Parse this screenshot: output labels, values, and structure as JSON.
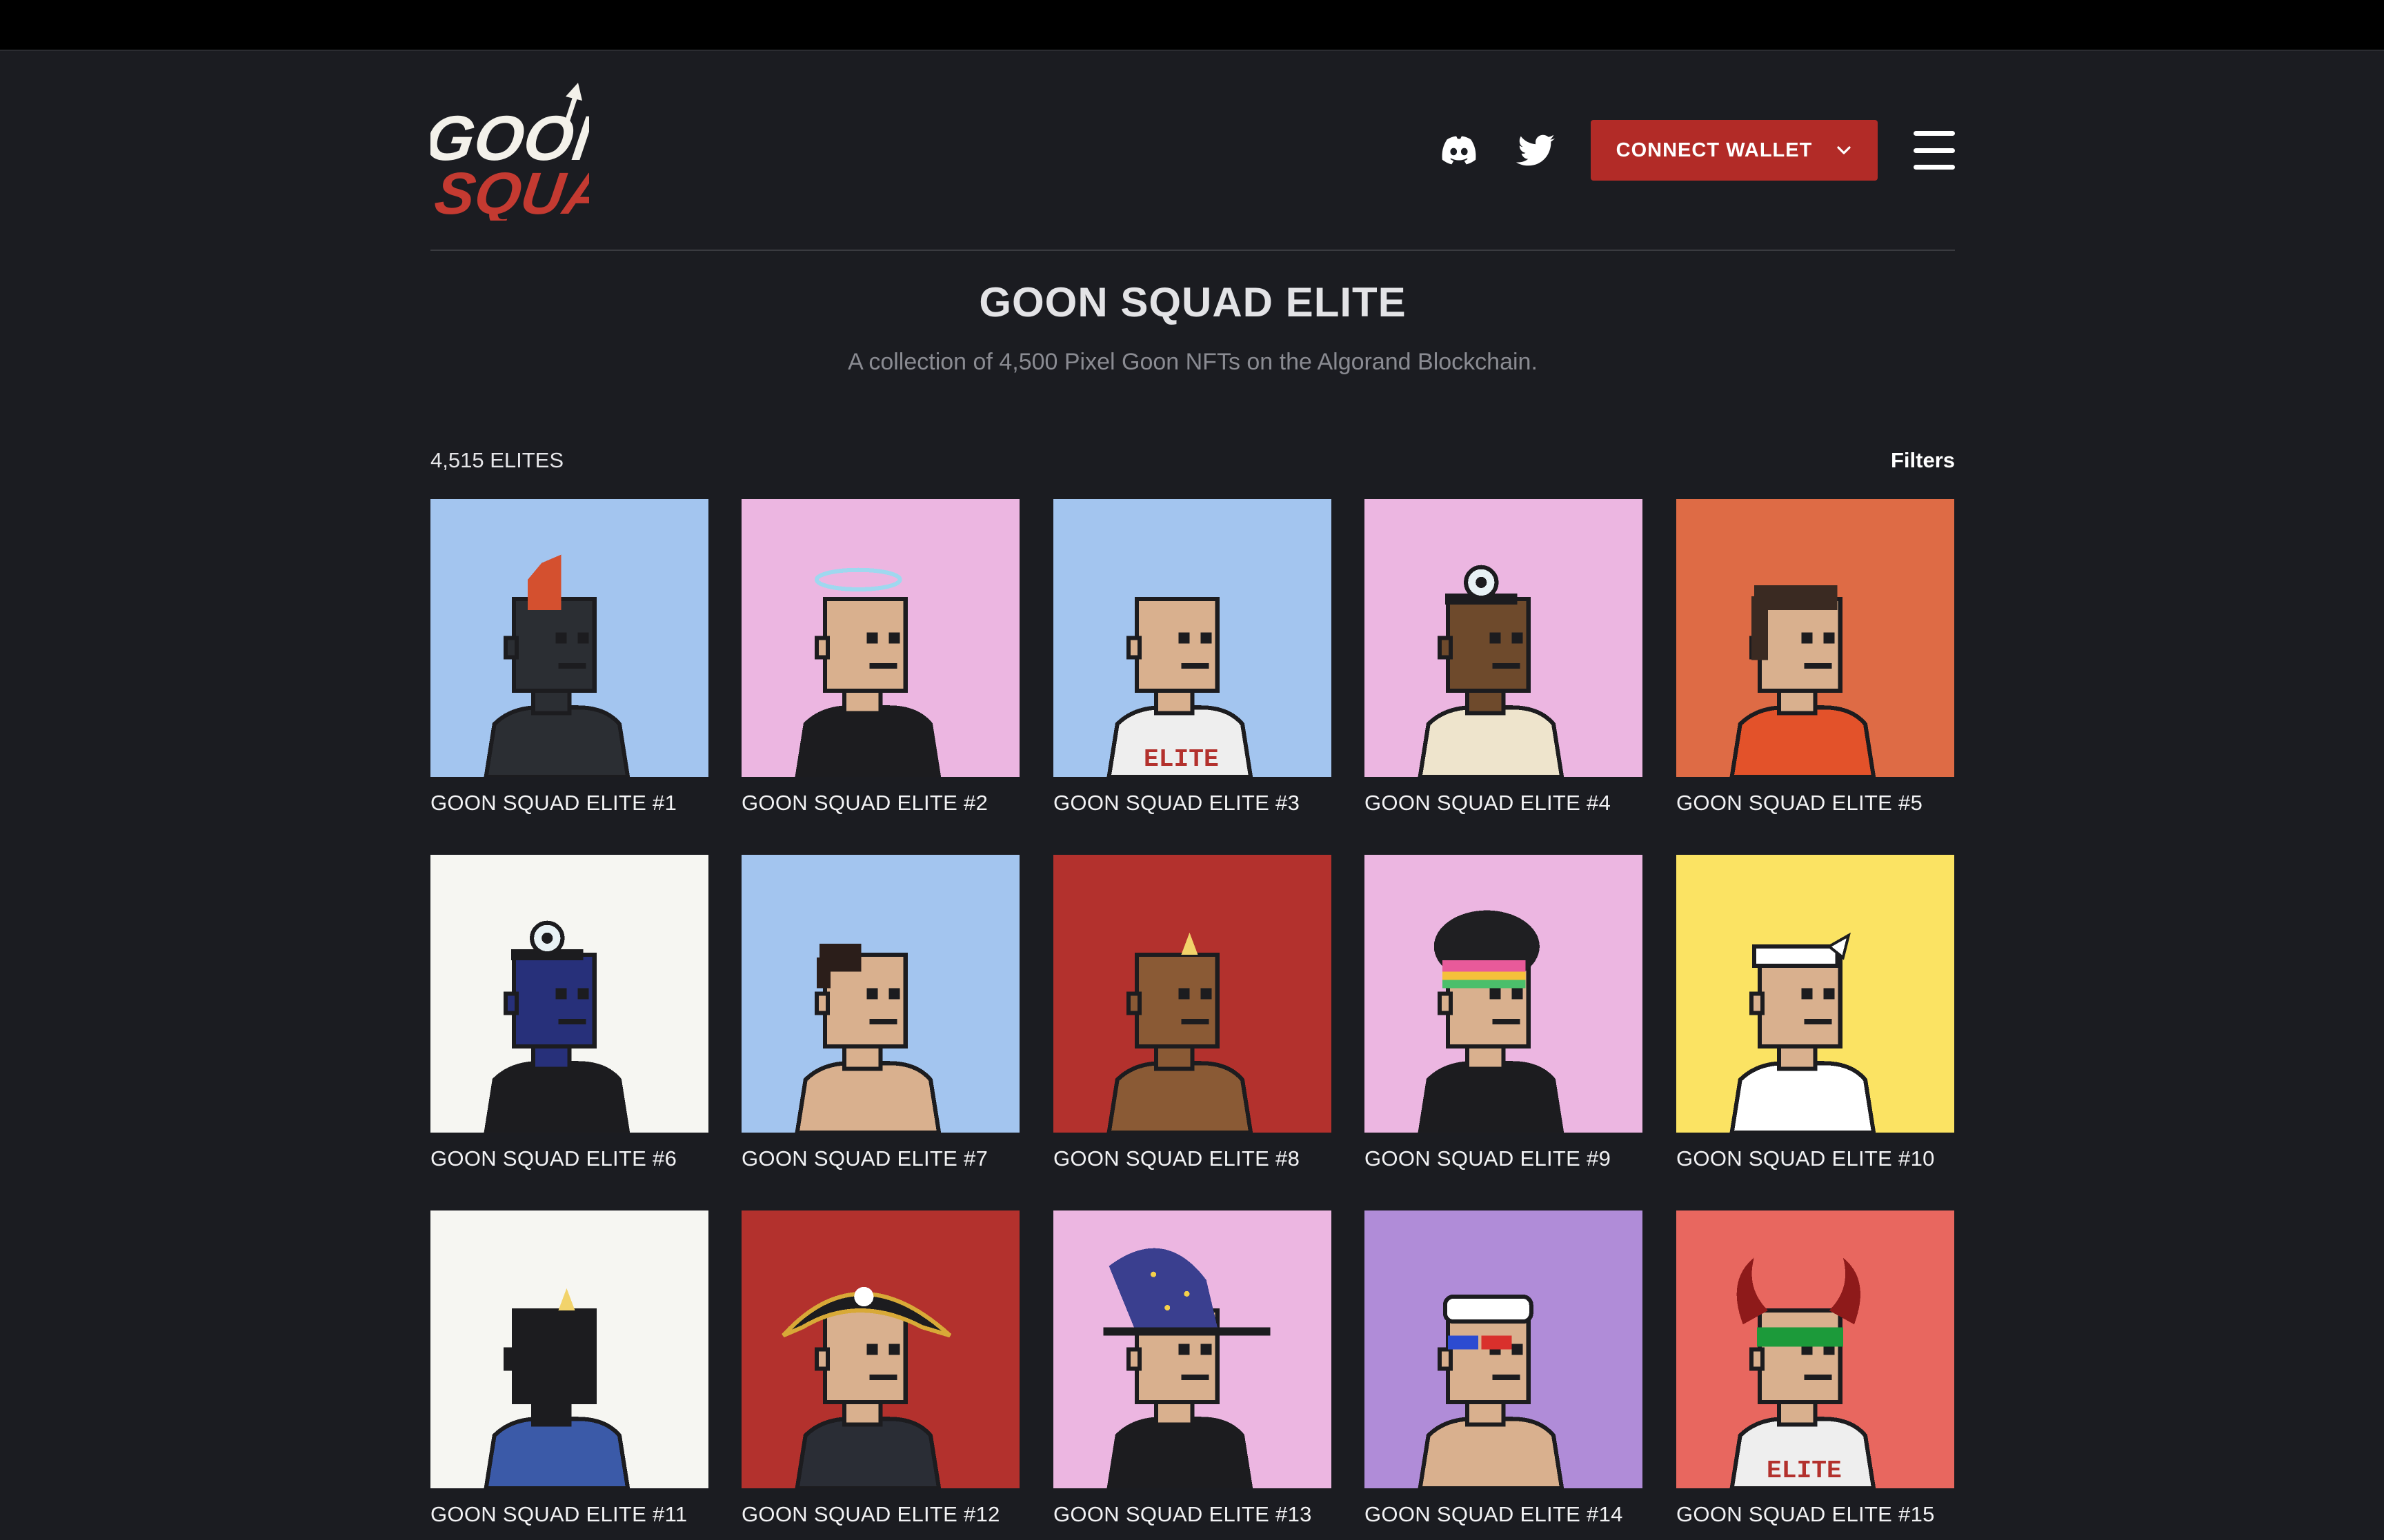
{
  "header": {
    "logo_text": [
      "GOON",
      "SQUAD"
    ],
    "connect_label": "CONNECT WALLET",
    "icons": {
      "discord": "discord-icon",
      "twitter": "twitter-icon",
      "menu": "hamburger-menu-icon",
      "chevron": "chevron-down-icon"
    }
  },
  "hero": {
    "title": "GOON SQUAD ELITE",
    "subtitle": "A collection of 4,500 Pixel Goon NFTs on the Algorand Blockchain."
  },
  "collection": {
    "count_label": "4,515 ELITES",
    "filters_label": "Filters",
    "items": [
      {
        "name": "GOON SQUAD ELITE #1",
        "bg": "#a3c5ef",
        "skin": "#2b2e33",
        "hat": "mohawk",
        "hatColor": "#d4502f",
        "outfit": "#2b2e33"
      },
      {
        "name": "GOON SQUAD ELITE #2",
        "bg": "#ecb6e1",
        "skin": "#d9b08e",
        "hat": "halo",
        "hatColor": "#9fd8ef",
        "outfit": "#1c1c1f"
      },
      {
        "name": "GOON SQUAD ELITE #3",
        "bg": "#a3c5ef",
        "skin": "#d9b08e",
        "hat": "none",
        "hatColor": "",
        "outfit": "#eeeeee",
        "shirtText": "ELITE"
      },
      {
        "name": "GOON SQUAD ELITE #4",
        "bg": "#ecb6e1",
        "skin": "#6e4a2c",
        "hat": "lamp",
        "hatColor": "#e8f2f5",
        "outfit": "#eee4cc"
      },
      {
        "name": "GOON SQUAD ELITE #5",
        "bg": "#de6b45",
        "skin": "#d9b08e",
        "hat": "longhair",
        "hatColor": "#3a2a22",
        "outfit": "#e3522a"
      },
      {
        "name": "GOON SQUAD ELITE #6",
        "bg": "#f6f6f2",
        "skin": "#27307a",
        "hat": "lamp",
        "hatColor": "#e8f2f5",
        "outfit": "#1c1c1f"
      },
      {
        "name": "GOON SQUAD ELITE #7",
        "bg": "#a3c5ef",
        "skin": "#d9b08e",
        "hat": "hair",
        "hatColor": "#2b1e1a",
        "outfit": "#d9b08e"
      },
      {
        "name": "GOON SQUAD ELITE #8",
        "bg": "#b3312d",
        "skin": "#8a5a35",
        "hat": "horn",
        "hatColor": "#f2d36b",
        "outfit": "#8a5a35"
      },
      {
        "name": "GOON SQUAD ELITE #9",
        "bg": "#ecb6e1",
        "skin": "#d9b08e",
        "hat": "afro",
        "hatColor": "#1f1f22",
        "outfit": "#1c1c1f"
      },
      {
        "name": "GOON SQUAD ELITE #10",
        "bg": "#fbe363",
        "skin": "#d9b08e",
        "hat": "bandana",
        "hatColor": "#ffffff",
        "outfit": "#ffffff"
      },
      {
        "name": "GOON SQUAD ELITE #11",
        "bg": "#f6f6f2",
        "skin": "#1c1c1f",
        "hat": "horn",
        "hatColor": "#f2d36b",
        "outfit": "#3b5aa8"
      },
      {
        "name": "GOON SQUAD ELITE #12",
        "bg": "#b3312d",
        "skin": "#d9b08e",
        "hat": "pirate",
        "hatColor": "#1c1c1f",
        "outfit": "#2a2d35"
      },
      {
        "name": "GOON SQUAD ELITE #13",
        "bg": "#ecb6e1",
        "skin": "#d9b08e",
        "hat": "wizard",
        "hatColor": "#3a3f8f",
        "outfit": "#1c1c1f"
      },
      {
        "name": "GOON SQUAD ELITE #14",
        "bg": "#b08cd8",
        "skin": "#d9b08e",
        "hat": "sailor",
        "hatColor": "#ffffff",
        "outfit": "#d9b08e"
      },
      {
        "name": "GOON SQUAD ELITE #15",
        "bg": "#e8675f",
        "skin": "#d9b08e",
        "hat": "devil",
        "hatColor": "#8e1a1a",
        "outfit": "#eeeeee",
        "shirtText": "ELITE"
      }
    ]
  }
}
